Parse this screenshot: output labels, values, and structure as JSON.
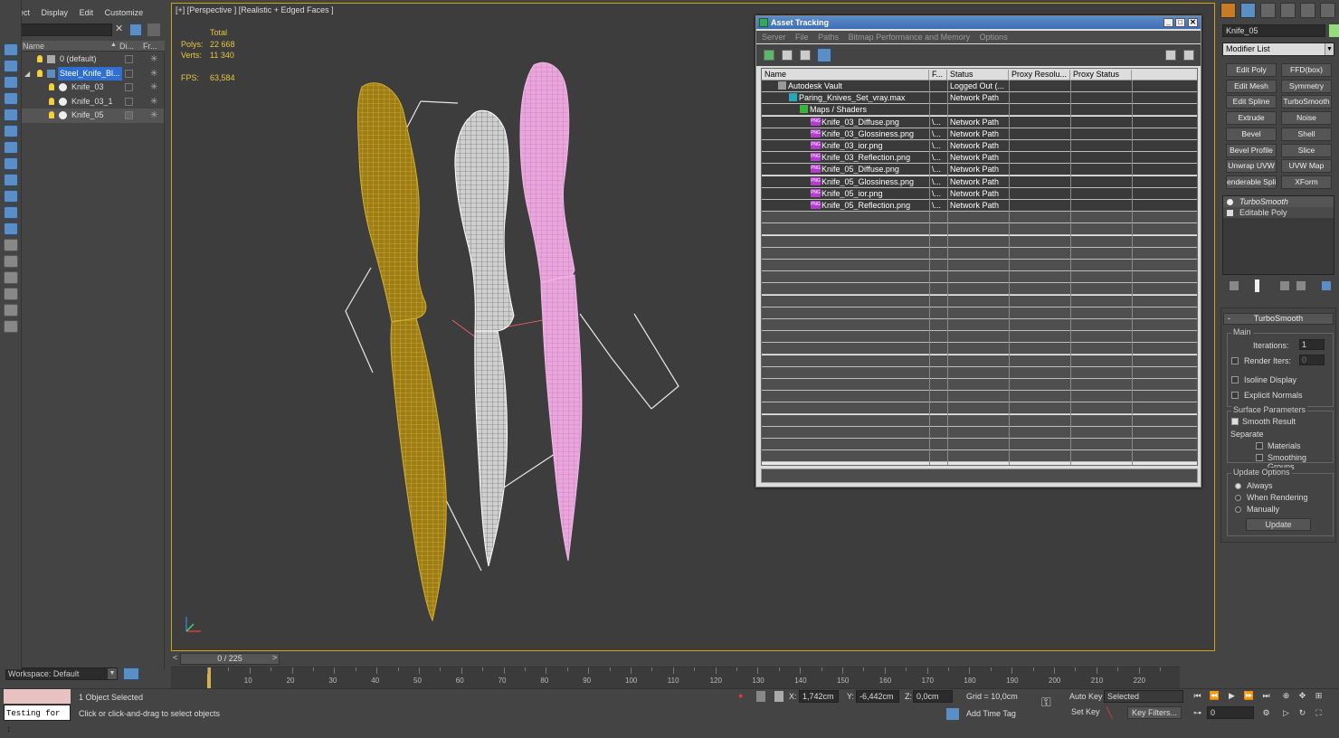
{
  "scene_explorer": {
    "menu": [
      "Select",
      "Display",
      "Edit",
      "Customize"
    ],
    "columns": [
      "Name",
      "Di...",
      "Fr..."
    ],
    "rows": [
      {
        "label": "0 (default)",
        "kind": "layer"
      },
      {
        "label": "Steel_Knife_Bl...",
        "kind": "layer-selected"
      },
      {
        "label": "Knife_03",
        "kind": "object"
      },
      {
        "label": "Knife_03_1",
        "kind": "object"
      },
      {
        "label": "Knife_05",
        "kind": "object-highlight"
      }
    ],
    "workspace": "Workspace: Default"
  },
  "viewport": {
    "label": "[+] [Perspective ] [Realistic + Edged Faces ]",
    "stats": {
      "total_label": "Total",
      "polys_label": "Polys:",
      "polys": "22 668",
      "verts_label": "Verts:",
      "verts": "11 340",
      "fps_label": "FPS:",
      "fps": "63,584"
    },
    "knife_colors": {
      "knife1": "#c9a220",
      "knife2": "#f2f2f2",
      "knife3": "#f0a8e4"
    }
  },
  "asset_tracking": {
    "title": "Asset Tracking",
    "menu": [
      "Server",
      "File",
      "Paths",
      "Bitmap Performance and Memory",
      "Options"
    ],
    "columns": [
      "Name",
      "F...",
      "Status",
      "Proxy Resolu...",
      "Proxy Status"
    ],
    "rows": [
      {
        "name": "Autodesk Vault",
        "f": "",
        "status": "Logged Out (...",
        "indent": 0,
        "icon": "vault"
      },
      {
        "name": "Paring_Knives_Set_vray.max",
        "f": "",
        "status": "Network Path",
        "indent": 1,
        "icon": "max"
      },
      {
        "name": "Maps / Shaders",
        "f": "",
        "status": "",
        "indent": 2,
        "icon": "maps"
      },
      {
        "name": "Knife_03_Diffuse.png",
        "f": "\\...",
        "status": "Network Path",
        "indent": 3,
        "icon": "png"
      },
      {
        "name": "Knife_03_Glossiness.png",
        "f": "\\...",
        "status": "Network Path",
        "indent": 3,
        "icon": "png"
      },
      {
        "name": "Knife_03_ior.png",
        "f": "\\...",
        "status": "Network Path",
        "indent": 3,
        "icon": "png"
      },
      {
        "name": "Knife_03_Reflection.png",
        "f": "\\...",
        "status": "Network Path",
        "indent": 3,
        "icon": "png"
      },
      {
        "name": "Knife_05_Diffuse.png",
        "f": "\\...",
        "status": "Network Path",
        "indent": 3,
        "icon": "png"
      },
      {
        "name": "Knife_05_Glossiness.png",
        "f": "\\...",
        "status": "Network Path",
        "indent": 3,
        "icon": "png"
      },
      {
        "name": "Knife_05_ior.png",
        "f": "\\...",
        "status": "Network Path",
        "indent": 3,
        "icon": "png"
      },
      {
        "name": "Knife_05_Reflection.png",
        "f": "\\...",
        "status": "Network Path",
        "indent": 3,
        "icon": "png"
      }
    ],
    "png_badge": "PNG"
  },
  "command_panel": {
    "object_name": "Knife_05",
    "object_color": "#94dc7c",
    "modifier_list": "Modifier List",
    "buttons": [
      [
        "Edit Poly",
        "FFD(box)"
      ],
      [
        "Edit Mesh",
        "Symmetry"
      ],
      [
        "Edit Spline",
        "TurboSmooth"
      ],
      [
        "Extrude",
        "Noise"
      ],
      [
        "Bevel",
        "Shell"
      ],
      [
        "Bevel Profile",
        "Slice"
      ],
      [
        "Unwrap UVW",
        "UVW Map"
      ],
      [
        "enderable Splin",
        "XForm"
      ]
    ],
    "stack": [
      "TurboSmooth",
      "Editable Poly"
    ],
    "rollout_title": "TurboSmooth",
    "main_group": "Main",
    "iterations_label": "Iterations:",
    "iterations": "1",
    "render_iters_label": "Render Iters:",
    "render_iters": "0",
    "isoline": "Isoline Display",
    "explicit_normals": "Explicit Normals",
    "surface_group": "Surface Parameters",
    "smooth_result": "Smooth Result",
    "separate_label": "Separate",
    "materials": "Materials",
    "smoothing_groups": "Smoothing Groups",
    "update_group": "Update Options",
    "always": "Always",
    "when_rendering": "When Rendering",
    "manually": "Manually",
    "update_button": "Update"
  },
  "timeline": {
    "frame": "0 / 225",
    "ticks": [
      "10",
      "20",
      "30",
      "40",
      "50",
      "60",
      "70",
      "80",
      "90",
      "100",
      "110",
      "120",
      "130",
      "140",
      "150",
      "160",
      "170",
      "180",
      "190",
      "200",
      "210",
      "220"
    ]
  },
  "statusbar": {
    "listener": "Testing for :",
    "selected": "1 Object Selected",
    "prompt": "Click or click-and-drag to select objects",
    "x_label": "X:",
    "x": "1,742cm",
    "y_label": "Y:",
    "y": "-6,442cm",
    "z_label": "Z:",
    "z": "0,0cm",
    "grid": "Grid = 10,0cm",
    "add_time_tag": "Add Time Tag",
    "auto_key": "Auto Key",
    "set_key": "Set Key",
    "key_mode": "Selected",
    "key_filters": "Key Filters...",
    "frame_field": "0"
  }
}
